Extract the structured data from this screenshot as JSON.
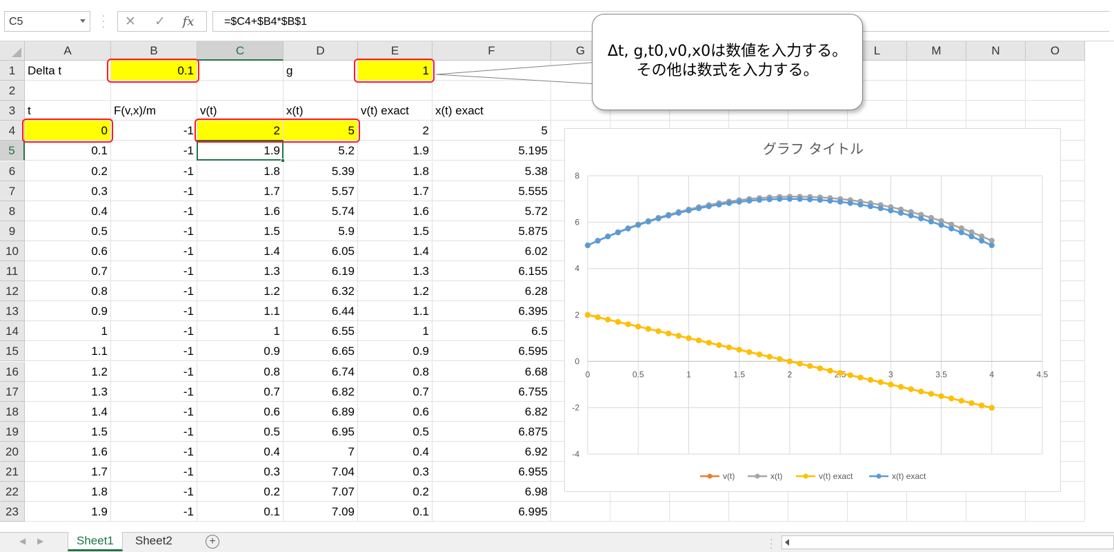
{
  "formula_bar": {
    "name_box": "C5",
    "cancel_icon": "✕",
    "enter_icon": "✓",
    "fx_icon": "fx",
    "formula": "=$C4+$B4*$B$1"
  },
  "columns": [
    "A",
    "B",
    "C",
    "D",
    "E",
    "F",
    "G",
    "H",
    "I",
    "J",
    "K",
    "L",
    "M",
    "N",
    "O"
  ],
  "selected_column": "C",
  "selected_row": "5",
  "rows": [
    {
      "n": "1",
      "A": "Delta t",
      "B": "0.1",
      "C": "",
      "D": "g",
      "E": "1",
      "F": ""
    },
    {
      "n": "2",
      "A": "",
      "B": "",
      "C": "",
      "D": "",
      "E": "",
      "F": ""
    },
    {
      "n": "3",
      "A": "t",
      "B": "F(v,x)/m",
      "C": "v(t)",
      "D": "x(t)",
      "E": "v(t) exact",
      "F": "x(t) exact"
    },
    {
      "n": "4",
      "A": "0",
      "B": "-1",
      "C": "2",
      "D": "5",
      "E": "2",
      "F": "5"
    },
    {
      "n": "5",
      "A": "0.1",
      "B": "-1",
      "C": "1.9",
      "D": "5.2",
      "E": "1.9",
      "F": "5.195"
    },
    {
      "n": "6",
      "A": "0.2",
      "B": "-1",
      "C": "1.8",
      "D": "5.39",
      "E": "1.8",
      "F": "5.38"
    },
    {
      "n": "7",
      "A": "0.3",
      "B": "-1",
      "C": "1.7",
      "D": "5.57",
      "E": "1.7",
      "F": "5.555"
    },
    {
      "n": "8",
      "A": "0.4",
      "B": "-1",
      "C": "1.6",
      "D": "5.74",
      "E": "1.6",
      "F": "5.72"
    },
    {
      "n": "9",
      "A": "0.5",
      "B": "-1",
      "C": "1.5",
      "D": "5.9",
      "E": "1.5",
      "F": "5.875"
    },
    {
      "n": "10",
      "A": "0.6",
      "B": "-1",
      "C": "1.4",
      "D": "6.05",
      "E": "1.4",
      "F": "6.02"
    },
    {
      "n": "11",
      "A": "0.7",
      "B": "-1",
      "C": "1.3",
      "D": "6.19",
      "E": "1.3",
      "F": "6.155"
    },
    {
      "n": "12",
      "A": "0.8",
      "B": "-1",
      "C": "1.2",
      "D": "6.32",
      "E": "1.2",
      "F": "6.28"
    },
    {
      "n": "13",
      "A": "0.9",
      "B": "-1",
      "C": "1.1",
      "D": "6.44",
      "E": "1.1",
      "F": "6.395"
    },
    {
      "n": "14",
      "A": "1",
      "B": "-1",
      "C": "1",
      "D": "6.55",
      "E": "1",
      "F": "6.5"
    },
    {
      "n": "15",
      "A": "1.1",
      "B": "-1",
      "C": "0.9",
      "D": "6.65",
      "E": "0.9",
      "F": "6.595"
    },
    {
      "n": "16",
      "A": "1.2",
      "B": "-1",
      "C": "0.8",
      "D": "6.74",
      "E": "0.8",
      "F": "6.68"
    },
    {
      "n": "17",
      "A": "1.3",
      "B": "-1",
      "C": "0.7",
      "D": "6.82",
      "E": "0.7",
      "F": "6.755"
    },
    {
      "n": "18",
      "A": "1.4",
      "B": "-1",
      "C": "0.6",
      "D": "6.89",
      "E": "0.6",
      "F": "6.82"
    },
    {
      "n": "19",
      "A": "1.5",
      "B": "-1",
      "C": "0.5",
      "D": "6.95",
      "E": "0.5",
      "F": "6.875"
    },
    {
      "n": "20",
      "A": "1.6",
      "B": "-1",
      "C": "0.4",
      "D": "7",
      "E": "0.4",
      "F": "6.92"
    },
    {
      "n": "21",
      "A": "1.7",
      "B": "-1",
      "C": "0.3",
      "D": "7.04",
      "E": "0.3",
      "F": "6.955"
    },
    {
      "n": "22",
      "A": "1.8",
      "B": "-1",
      "C": "0.2",
      "D": "7.07",
      "E": "0.2",
      "F": "6.98"
    },
    {
      "n": "23",
      "A": "1.9",
      "B": "-1",
      "C": "0.1",
      "D": "7.09",
      "E": "0.1",
      "F": "6.995"
    }
  ],
  "callout": {
    "line1": "Δt, g,t0,v0,x0は数値を入力する。",
    "line2": "その他は数式を入力する。"
  },
  "colors": {
    "highlight": "#ffff00",
    "annotation_border": "#ff1a1a",
    "excel_green": "#217346",
    "series_vt": "#ed7d31",
    "series_xt": "#a5a5a5",
    "series_vt_exact": "#ffc000",
    "series_xt_exact": "#5b9bd5"
  },
  "chart_data": {
    "type": "scatter",
    "title": "グラフ タイトル",
    "xlim": [
      0,
      4.5
    ],
    "ylim": [
      -4,
      8
    ],
    "x_ticks": [
      "0",
      "0.5",
      "1",
      "1.5",
      "2",
      "2.5",
      "3",
      "3.5",
      "4",
      "4.5"
    ],
    "y_ticks": [
      "-4",
      "-2",
      "0",
      "2",
      "4",
      "6",
      "8"
    ],
    "grid": true,
    "legend_position": "bottom",
    "x": [
      0,
      0.1,
      0.2,
      0.3,
      0.4,
      0.5,
      0.6,
      0.7,
      0.8,
      0.9,
      1.0,
      1.1,
      1.2,
      1.3,
      1.4,
      1.5,
      1.6,
      1.7,
      1.8,
      1.9,
      2.0,
      2.1,
      2.2,
      2.3,
      2.4,
      2.5,
      2.6,
      2.7,
      2.8,
      2.9,
      3.0,
      3.1,
      3.2,
      3.3,
      3.4,
      3.5,
      3.6,
      3.7,
      3.8,
      3.9,
      4.0
    ],
    "series": [
      {
        "name": "v(t)",
        "color": "#ed7d31",
        "values": [
          2,
          1.9,
          1.8,
          1.7,
          1.6,
          1.5,
          1.4,
          1.3,
          1.2,
          1.1,
          1,
          0.9,
          0.8,
          0.7,
          0.6,
          0.5,
          0.4,
          0.3,
          0.2,
          0.1,
          0,
          -0.1,
          -0.2,
          -0.3,
          -0.4,
          -0.5,
          -0.6,
          -0.7,
          -0.8,
          -0.9,
          -1,
          -1.1,
          -1.2,
          -1.3,
          -1.4,
          -1.5,
          -1.6,
          -1.7,
          -1.8,
          -1.9,
          -2
        ]
      },
      {
        "name": "x(t)",
        "color": "#a5a5a5",
        "values": [
          5,
          5.2,
          5.39,
          5.57,
          5.74,
          5.9,
          6.05,
          6.19,
          6.32,
          6.44,
          6.55,
          6.65,
          6.74,
          6.82,
          6.89,
          6.95,
          7,
          7.04,
          7.07,
          7.09,
          7.1,
          7.1,
          7.09,
          7.07,
          7.04,
          7,
          6.95,
          6.89,
          6.82,
          6.74,
          6.65,
          6.55,
          6.44,
          6.32,
          6.19,
          6.05,
          5.9,
          5.74,
          5.57,
          5.39,
          5.2
        ]
      },
      {
        "name": "v(t) exact",
        "color": "#ffc000",
        "values": [
          2,
          1.9,
          1.8,
          1.7,
          1.6,
          1.5,
          1.4,
          1.3,
          1.2,
          1.1,
          1,
          0.9,
          0.8,
          0.7,
          0.6,
          0.5,
          0.4,
          0.3,
          0.2,
          0.1,
          0,
          -0.1,
          -0.2,
          -0.3,
          -0.4,
          -0.5,
          -0.6,
          -0.7,
          -0.8,
          -0.9,
          -1,
          -1.1,
          -1.2,
          -1.3,
          -1.4,
          -1.5,
          -1.6,
          -1.7,
          -1.8,
          -1.9,
          -2
        ]
      },
      {
        "name": "x(t) exact",
        "color": "#5b9bd5",
        "values": [
          5,
          5.195,
          5.38,
          5.555,
          5.72,
          5.875,
          6.02,
          6.155,
          6.28,
          6.395,
          6.5,
          6.595,
          6.68,
          6.755,
          6.82,
          6.875,
          6.92,
          6.955,
          6.98,
          6.995,
          7,
          6.995,
          6.98,
          6.955,
          6.92,
          6.875,
          6.82,
          6.755,
          6.68,
          6.595,
          6.5,
          6.395,
          6.28,
          6.155,
          6.02,
          5.875,
          5.72,
          5.555,
          5.38,
          5.195,
          5
        ]
      }
    ]
  },
  "sheet_tabs": [
    "Sheet1",
    "Sheet2"
  ],
  "active_sheet": "Sheet1"
}
